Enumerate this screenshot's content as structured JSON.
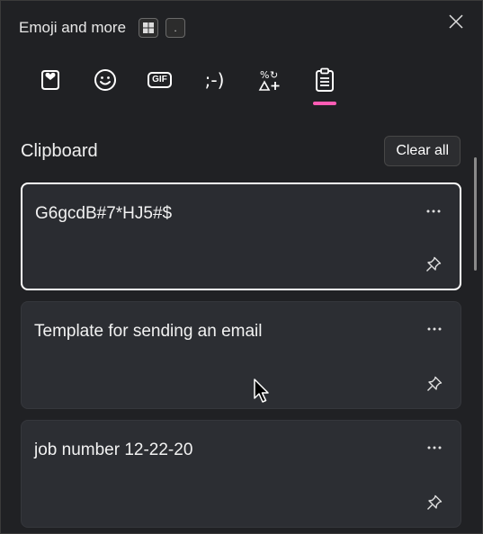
{
  "header": {
    "title": "Emoji and more",
    "shortcut_win_icon": "windows-logo-icon",
    "shortcut_key": "."
  },
  "close_icon": "close-icon",
  "tabs": [
    {
      "name": "favorites",
      "icon": "heart-icon",
      "active": false
    },
    {
      "name": "emoji",
      "icon": "smiley-icon",
      "active": false
    },
    {
      "name": "gif",
      "label": "GIF",
      "active": false
    },
    {
      "name": "kaomoji",
      "label": ";-)",
      "active": false
    },
    {
      "name": "symbols",
      "icon": "symbols-icon",
      "active": false
    },
    {
      "name": "clipboard",
      "icon": "clipboard-icon",
      "active": true
    }
  ],
  "accent_color": "#ff5cb4",
  "clipboard": {
    "title": "Clipboard",
    "clear_all_label": "Clear all",
    "items": [
      {
        "text": "G6gcdB#7*HJ5#$",
        "selected": true
      },
      {
        "text": "Template for sending an email",
        "selected": false
      },
      {
        "text": "job number 12-22-20",
        "selected": false
      }
    ]
  }
}
